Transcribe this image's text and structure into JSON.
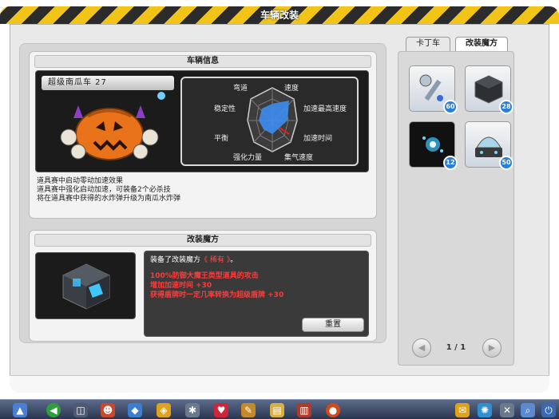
{
  "window": {
    "title": "车辆改装"
  },
  "vehicle_info": {
    "header": "车辆信息",
    "kart_name": "超级南瓜车 27",
    "stats_labels": {
      "top": "弯道",
      "top_right": "速度",
      "left": "稳定性",
      "right_top": "加速最高速度",
      "left_bottom": "平衡",
      "right_bottom": "加速时间",
      "bottom_left": "强化力量",
      "bottom_right": "集气速度"
    },
    "description": [
      "道具赛中启动零动加速效果",
      "道具赛中强化启动加速，可装备2个必杀技",
      "将在道具赛中获得的水炸弹升级为南瓜水炸弹"
    ]
  },
  "tuning_magic": {
    "header": "改装魔方",
    "equipped_prefix": "装备了改装魔方",
    "equipped_name": "《 稀有 》",
    "equipped_suffix": "。",
    "effects": [
      "100%防御大魔王类型道具的攻击",
      "增加加速时间 +30",
      "获得盾牌时一定几率转换为超级盾牌 +30"
    ],
    "reset_button": "重置"
  },
  "tabs": [
    {
      "label": "卡丁车"
    },
    {
      "label": "改装魔方"
    }
  ],
  "items": [
    {
      "icon": "wrench-icon",
      "count": "60"
    },
    {
      "icon": "dark-cube-icon",
      "count": "28"
    },
    {
      "icon": "blue-sparkle-icon",
      "count": "12"
    },
    {
      "icon": "dome-device-icon",
      "count": "50"
    }
  ],
  "pagination": {
    "text": "1 / 1"
  },
  "taskbar": {
    "icons": [
      "start-icon",
      "back-icon",
      "cart-icon",
      "character-icon",
      "shop-icon",
      "gift-icon",
      "gear-icon",
      "heart-icon",
      "bag-icon",
      "folder-icon",
      "book-icon",
      "game-icon",
      "note-icon",
      "network-icon",
      "tools-icon",
      "search-icon",
      "power-icon"
    ]
  }
}
